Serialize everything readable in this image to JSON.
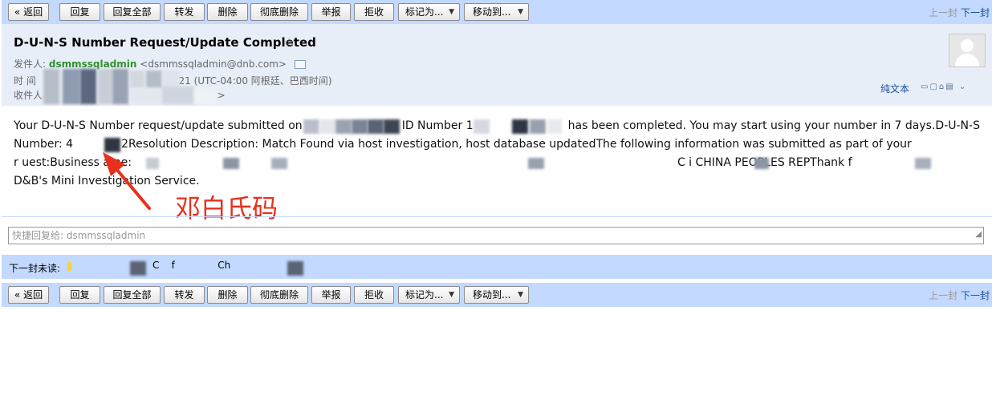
{
  "toolbar": {
    "back": "« 返回",
    "reply": "回复",
    "reply_all": "回复全部",
    "forward": "转发",
    "delete": "删除",
    "delete_permanently": "彻底删除",
    "report": "举报",
    "reject": "拒收",
    "mark_as": "标记为...",
    "move_to": "移动到...",
    "dropdown_arrow": "▼",
    "prev_message": "上一封",
    "next_message": "下一封"
  },
  "message": {
    "subject": "D-U-N-S Number Request/Update Completed",
    "star_glyph": "☆",
    "from_label": "发件人:",
    "sender_name": "dsmmssqladmin",
    "sender_email": "<dsmmssqladmin@dnb.com>",
    "time_label": "时 间",
    "time_value": "21 (UTC-04:00 阿根廷、巴西时间)",
    "to_label": "收件人",
    "to_tail": ">",
    "plain_text_link": "纯文本",
    "body_p1": "Your D-U-N-S Number request/update submitted on",
    "body_p2": "ID Number 1",
    "body_p3": "has been completed.  You may start using your number in 7 days.D-U-N-S",
    "body_line2_a": "Number: 4",
    "body_line2_b": "2Resolution Description: Match Found via host investigation, host database updatedThe following information was submitted as part of your",
    "body_line3_a": "r    uest:Business   ame:",
    "body_line3_b": "C    i    CHINA PEOPLES REPThank      f",
    "body_line4": "D&B's Mini Investigation Service."
  },
  "annotation": {
    "label": "邓白氏码",
    "arrow_color": "#e8301c"
  },
  "quick_reply": {
    "placeholder": "快捷回复给: dsmmssqladmin"
  },
  "next_unread": {
    "label": "下一封未读:",
    "partial_text": "C    f              Ch             "
  },
  "colors": {
    "toolbar_bg": "#c3d9ff",
    "header_bg": "#e8eef7",
    "link": "#1a4ea0",
    "sender": "#2f8f2f",
    "annotation": "#e8301c"
  }
}
